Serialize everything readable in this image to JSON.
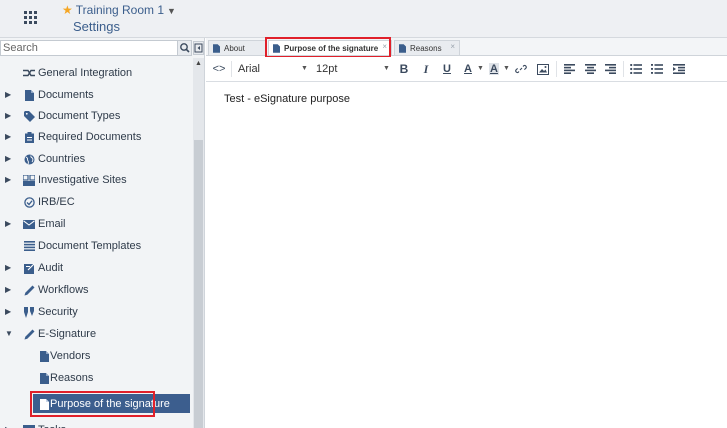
{
  "header": {
    "room_name": "Training Room 1",
    "page_title": "Settings"
  },
  "search": {
    "placeholder": "Search"
  },
  "tree": [
    {
      "label": "General Integration",
      "icon": "integration-icon",
      "expandable": false,
      "indent": 1
    },
    {
      "label": "Documents",
      "icon": "document-icon",
      "expandable": true,
      "indent": 1
    },
    {
      "label": "Document Types",
      "icon": "tag-icon",
      "expandable": true,
      "indent": 1
    },
    {
      "label": "Required Documents",
      "icon": "clipboard-icon",
      "expandable": true,
      "indent": 1
    },
    {
      "label": "Countries",
      "icon": "globe-icon",
      "expandable": true,
      "indent": 1
    },
    {
      "label": "Investigative Sites",
      "icon": "sites-icon",
      "expandable": true,
      "indent": 1
    },
    {
      "label": "IRB/EC",
      "icon": "check-circle-icon",
      "expandable": false,
      "indent": 1
    },
    {
      "label": "Email",
      "icon": "email-icon",
      "expandable": true,
      "indent": 1
    },
    {
      "label": "Document Templates",
      "icon": "list-icon",
      "expandable": false,
      "indent": 1
    },
    {
      "label": "Audit",
      "icon": "audit-icon",
      "expandable": true,
      "indent": 1
    },
    {
      "label": "Workflows",
      "icon": "pencil-icon",
      "expandable": true,
      "indent": 1
    },
    {
      "label": "Security",
      "icon": "security-icon",
      "expandable": true,
      "indent": 1
    },
    {
      "label": "E-Signature",
      "icon": "pencil-icon",
      "expandable": true,
      "expanded": true,
      "indent": 1
    },
    {
      "label": "Vendors",
      "icon": "document-icon",
      "expandable": false,
      "indent": 2
    },
    {
      "label": "Reasons",
      "icon": "document-icon",
      "expandable": false,
      "indent": 2
    },
    {
      "label": "Purpose of the signature",
      "icon": "document-icon",
      "expandable": false,
      "indent": 2,
      "selected": true
    },
    {
      "label": "Tasks",
      "icon": "table-icon",
      "expandable": true,
      "indent": 1
    }
  ],
  "tabs": [
    {
      "label": "About",
      "active": false,
      "closable": false
    },
    {
      "label": "Purpose of the signature",
      "active": true,
      "closable": true
    },
    {
      "label": "Reasons",
      "active": false,
      "closable": true
    }
  ],
  "toolbar": {
    "code_label": "<>",
    "font_family": "Arial",
    "font_size": "12pt",
    "bold": "B",
    "italic": "I",
    "underline": "U",
    "text_color": "A",
    "highlight": "A"
  },
  "editor": {
    "content": "Test - eSignature purpose"
  },
  "colors": {
    "accent": "#3c5e8e",
    "highlight_border": "#e0202a",
    "star": "#f5a623"
  }
}
